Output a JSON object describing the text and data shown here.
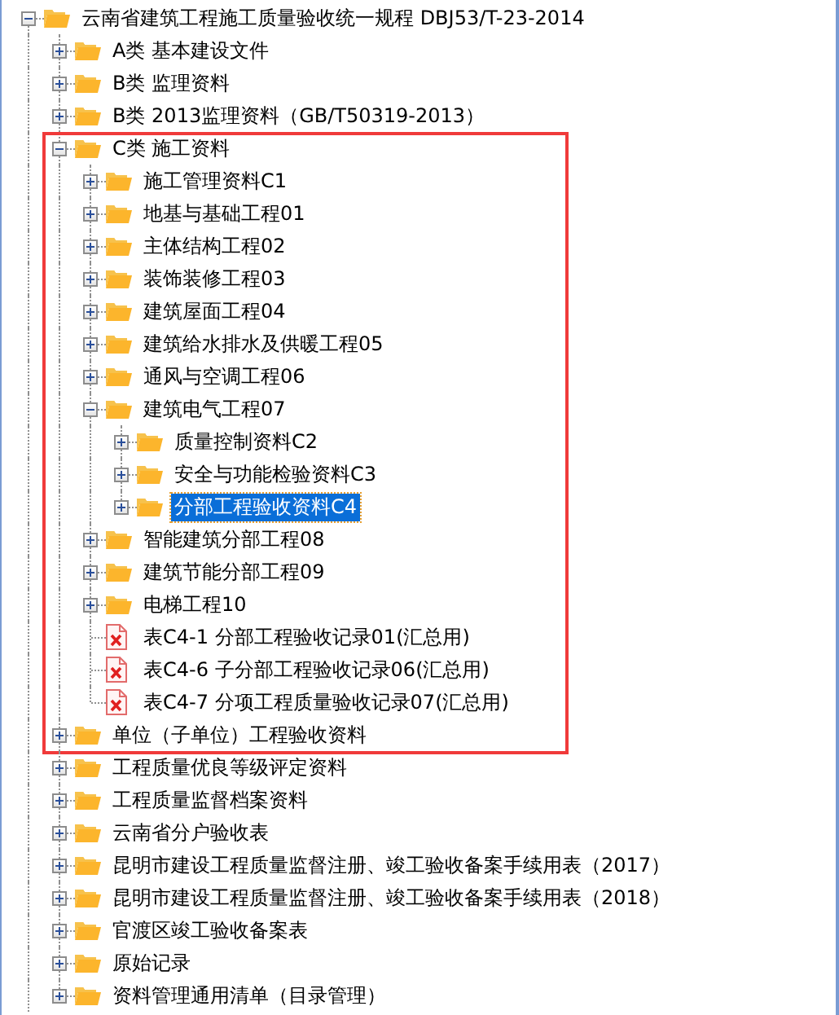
{
  "tree": [
    {
      "label": "云南省建筑工程施工质量验收统一规程 DBJ53/T-23-2014",
      "kind": "folder",
      "expanded": true,
      "selected": false,
      "children": [
        {
          "label": "A类 基本建设文件",
          "kind": "folder",
          "expanded": false,
          "selected": false,
          "boxed": false
        },
        {
          "label": "B类 监理资料",
          "kind": "folder",
          "expanded": false,
          "selected": false,
          "boxed": false
        },
        {
          "label": "B类 2013监理资料（GB/T50319-2013）",
          "kind": "folder",
          "expanded": false,
          "selected": false,
          "boxed": false
        },
        {
          "label": "C类 施工资料",
          "kind": "folder",
          "expanded": true,
          "selected": false,
          "boxed": true,
          "children": [
            {
              "label": "施工管理资料C1",
              "kind": "folder",
              "expanded": false,
              "selected": false
            },
            {
              "label": "地基与基础工程01",
              "kind": "folder",
              "expanded": false,
              "selected": false
            },
            {
              "label": "主体结构工程02",
              "kind": "folder",
              "expanded": false,
              "selected": false
            },
            {
              "label": "装饰装修工程03",
              "kind": "folder",
              "expanded": false,
              "selected": false
            },
            {
              "label": "建筑屋面工程04",
              "kind": "folder",
              "expanded": false,
              "selected": false
            },
            {
              "label": "建筑给水排水及供暖工程05",
              "kind": "folder",
              "expanded": false,
              "selected": false
            },
            {
              "label": "通风与空调工程06",
              "kind": "folder",
              "expanded": false,
              "selected": false
            },
            {
              "label": "建筑电气工程07",
              "kind": "folder",
              "expanded": true,
              "selected": false,
              "children": [
                {
                  "label": "质量控制资料C2",
                  "kind": "folder",
                  "expanded": false,
                  "selected": false
                },
                {
                  "label": "安全与功能检验资料C3",
                  "kind": "folder",
                  "expanded": false,
                  "selected": false
                },
                {
                  "label": "分部工程验收资料C4",
                  "kind": "folder",
                  "expanded": false,
                  "selected": true
                }
              ]
            },
            {
              "label": "智能建筑分部工程08",
              "kind": "folder",
              "expanded": false,
              "selected": false
            },
            {
              "label": "建筑节能分部工程09",
              "kind": "folder",
              "expanded": false,
              "selected": false
            },
            {
              "label": "电梯工程10",
              "kind": "folder",
              "expanded": false,
              "selected": false
            },
            {
              "label": "表C4-1 分部工程验收记录01(汇总用)",
              "kind": "file",
              "selected": false
            },
            {
              "label": "表C4-6 子分部工程验收记录06(汇总用)",
              "kind": "file",
              "selected": false
            },
            {
              "label": "表C4-7 分项工程质量验收记录07(汇总用)",
              "kind": "file",
              "selected": false
            }
          ]
        },
        {
          "label": "单位（子单位）工程验收资料",
          "kind": "folder",
          "expanded": false,
          "selected": false,
          "boxed": true
        },
        {
          "label": "工程质量优良等级评定资料",
          "kind": "folder",
          "expanded": false,
          "selected": false,
          "boxed": false
        },
        {
          "label": "工程质量监督档案资料",
          "kind": "folder",
          "expanded": false,
          "selected": false,
          "boxed": false
        },
        {
          "label": "云南省分户验收表",
          "kind": "folder",
          "expanded": false,
          "selected": false,
          "boxed": false
        },
        {
          "label": "昆明市建设工程质量监督注册、竣工验收备案手续用表（2017）",
          "kind": "folder",
          "expanded": false,
          "selected": false,
          "boxed": false
        },
        {
          "label": "昆明市建设工程质量监督注册、竣工验收备案手续用表（2018）",
          "kind": "folder",
          "expanded": false,
          "selected": false,
          "boxed": false
        },
        {
          "label": "官渡区竣工验收备案表",
          "kind": "folder",
          "expanded": false,
          "selected": false,
          "boxed": false
        },
        {
          "label": "原始记录",
          "kind": "folder",
          "expanded": false,
          "selected": false,
          "boxed": false
        },
        {
          "label": "资料管理通用清单（目录管理）",
          "kind": "folder",
          "expanded": false,
          "selected": false,
          "boxed": false
        }
      ]
    }
  ]
}
